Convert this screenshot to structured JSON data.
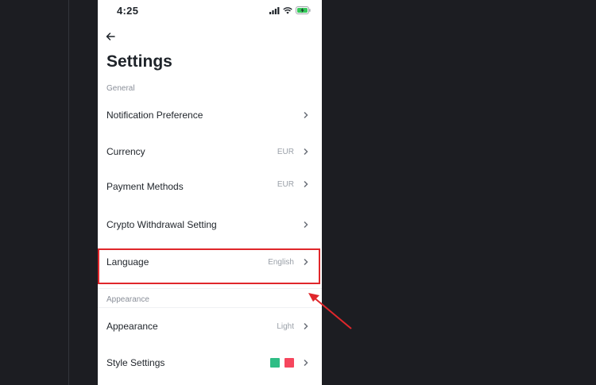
{
  "status_bar": {
    "time": "4:25",
    "icons": [
      "signal-icon",
      "wifi-icon",
      "battery-charging-icon"
    ]
  },
  "header": {
    "back_icon": "arrow-left-icon",
    "title": "Settings"
  },
  "sections": {
    "general": "General",
    "appearance": "Appearance"
  },
  "rows": {
    "notification": {
      "label": "Notification Preference",
      "value": ""
    },
    "currency": {
      "label": "Currency",
      "value": "EUR"
    },
    "payment": {
      "label": "Payment Methods",
      "value": "EUR"
    },
    "crypto": {
      "label": "Crypto Withdrawal Setting",
      "value": ""
    },
    "language": {
      "label": "Language",
      "value": "English"
    },
    "appearance": {
      "label": "Appearance",
      "value": "Light"
    },
    "style": {
      "label": "Style Settings",
      "value": ""
    }
  },
  "style_colors": {
    "up": "#2ebd85",
    "down": "#f6465d"
  },
  "annotation": {
    "highlight_color": "#e0272b"
  }
}
